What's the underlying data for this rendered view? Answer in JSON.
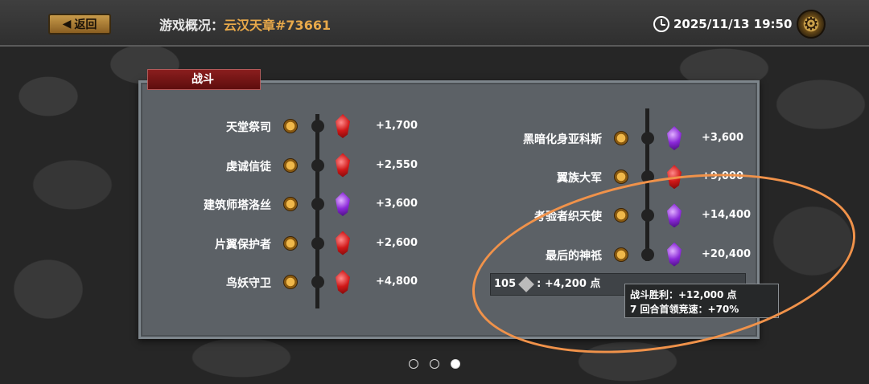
{
  "header": {
    "back_label": "返回",
    "title_prefix": "游戏概况：",
    "title_name": "云汉天章#73661",
    "datetime": "2025/11/13 19:50"
  },
  "panel": {
    "tab_label": "战斗",
    "left_column": [
      {
        "label": "天堂祭司",
        "points": "+1,700",
        "gem": "red"
      },
      {
        "label": "虔诚信徒",
        "points": "+2,550",
        "gem": "red"
      },
      {
        "label": "建筑师塔洛丝",
        "points": "+3,600",
        "gem": "purple"
      },
      {
        "label": "片翼保护者",
        "points": "+2,600",
        "gem": "red"
      },
      {
        "label": "鸟妖守卫",
        "points": "+4,800",
        "gem": "red"
      }
    ],
    "right_column": [
      {
        "label": "黑暗化身亚科斯",
        "points": "+3,600",
        "gem": "purple"
      },
      {
        "label": "翼族大军",
        "points": "+9,000",
        "gem": "red"
      },
      {
        "label": "考验者织天使",
        "points": "+14,400",
        "gem": "purple"
      },
      {
        "label": "最后的神祇",
        "points": "+20,400",
        "gem": "purple"
      }
    ],
    "score_bar": {
      "count": "105",
      "points": ": +4,200 点",
      "right_partial": "+12,000 点"
    },
    "tooltip": {
      "line1": "战斗胜利：+12,000 点",
      "line2": "7 回合首领竞速：+70%"
    }
  },
  "pager": {
    "total": 3,
    "active": 3
  },
  "colors": {
    "accent": "#e8a94a",
    "tab": "#8a1e1e",
    "annotation": "#f0924a"
  }
}
